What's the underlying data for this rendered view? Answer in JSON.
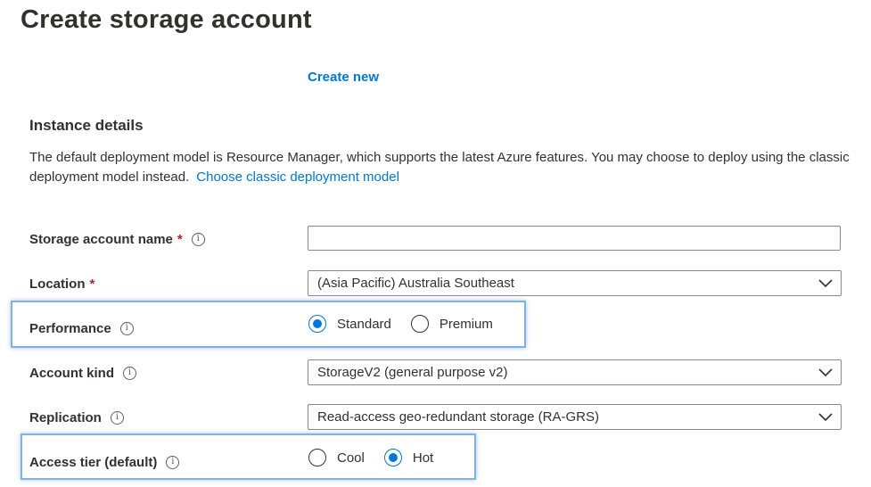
{
  "page": {
    "title": "Create storage account",
    "create_new_label": "Create new"
  },
  "instance_details": {
    "heading": "Instance details",
    "description": "The default deployment model is Resource Manager, which supports the latest Azure features. You may choose to deploy using the classic deployment model instead.",
    "classic_link": "Choose classic deployment model"
  },
  "fields": {
    "storage_account_name": {
      "label": "Storage account name",
      "required_mark": "*",
      "value": "",
      "info_icon": "info-icon"
    },
    "location": {
      "label": "Location",
      "required_mark": "*",
      "value": "(Asia Pacific) Australia Southeast"
    },
    "performance": {
      "label": "Performance",
      "options": [
        "Standard",
        "Premium"
      ],
      "selected": "Standard"
    },
    "account_kind": {
      "label": "Account kind",
      "value": "StorageV2 (general purpose v2)"
    },
    "replication": {
      "label": "Replication",
      "value": "Read-access geo-redundant storage (RA-GRS)"
    },
    "access_tier": {
      "label": "Access tier (default)",
      "options": [
        "Cool",
        "Hot"
      ],
      "selected": "Hot"
    }
  },
  "colors": {
    "accent": "#0078d4",
    "required": "#a4262c",
    "highlight_border": "#7fb2de",
    "text": "#323130"
  },
  "icons": {
    "info": "info-icon",
    "dropdown": "chevron-down-icon"
  }
}
